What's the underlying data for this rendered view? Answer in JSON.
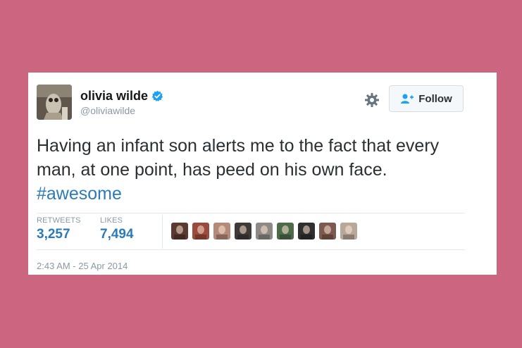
{
  "user": {
    "name": "olivia wilde",
    "handle": "@oliviawilde",
    "avatar_icon": "owl-photo-avatar",
    "verified": true
  },
  "actions": {
    "settings_icon": "gear-icon",
    "follow_label": "Follow"
  },
  "tweet": {
    "text": "Having an infant son alerts me to the fact that every man, at one point, has peed on his own face. ",
    "hashtag": "#awesome"
  },
  "stats": {
    "retweets_label": "RETWEETS",
    "retweets_count": "3,257",
    "likes_label": "LIKES",
    "likes_count": "7,494"
  },
  "likers": [
    {
      "color": "#5a3a30"
    },
    {
      "color": "#9b4a3e"
    },
    {
      "color": "#b58a7a"
    },
    {
      "color": "#3e3a38"
    },
    {
      "color": "#8d8a86"
    },
    {
      "color": "#4d6a4a"
    },
    {
      "color": "#2f2f2f"
    },
    {
      "color": "#7c5a4e"
    },
    {
      "color": "#b9a79a"
    }
  ],
  "timestamp": "2:43 AM - 25 Apr 2014",
  "colors": {
    "background": "#cc6580",
    "link": "#2b7bb9",
    "verified": "#1da1f2"
  }
}
